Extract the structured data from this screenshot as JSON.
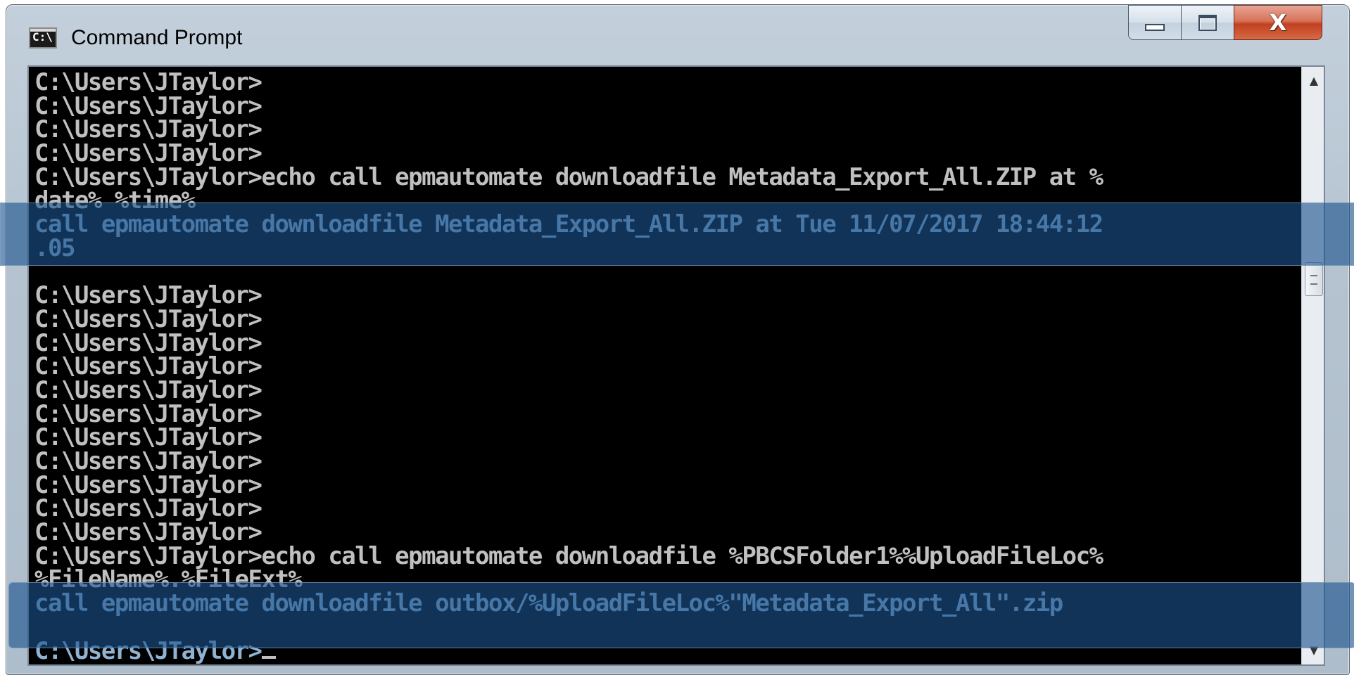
{
  "window": {
    "title": "Command Prompt",
    "icon": "cmd-icon",
    "icon_text": "C:\\",
    "controls": {
      "minimize": "minimize-icon",
      "maximize": "maximize-icon",
      "close_label": "X"
    }
  },
  "console": {
    "lines": [
      "C:\\Users\\JTaylor>",
      "C:\\Users\\JTaylor>",
      "C:\\Users\\JTaylor>",
      "C:\\Users\\JTaylor>",
      "C:\\Users\\JTaylor>echo call epmautomate downloadfile Metadata_Export_All.ZIP at %",
      "date% %time%",
      "call epmautomate downloadfile Metadata_Export_All.ZIP at Tue 11/07/2017 18:44:12",
      ".05",
      "",
      "C:\\Users\\JTaylor>",
      "C:\\Users\\JTaylor>",
      "C:\\Users\\JTaylor>",
      "C:\\Users\\JTaylor>",
      "C:\\Users\\JTaylor>",
      "C:\\Users\\JTaylor>",
      "C:\\Users\\JTaylor>",
      "C:\\Users\\JTaylor>",
      "C:\\Users\\JTaylor>",
      "C:\\Users\\JTaylor>",
      "C:\\Users\\JTaylor>",
      "C:\\Users\\JTaylor>echo call epmautomate downloadfile %PBCSFolder1%%UploadFileLoc%",
      "%FileName%.%FileExt%",
      "call epmautomate downloadfile outbox/%UploadFileLoc%\"Metadata_Export_All\".zip",
      "",
      "C:\\Users\\JTaylor>"
    ],
    "highlighted_line_indices": [
      6,
      7,
      22,
      23,
      24
    ],
    "cursor_after_last_line": true
  },
  "scrollbar": {
    "up_icon": "scroll-up-arrow-icon",
    "down_icon": "scroll-down-arrow-icon",
    "position": 0.33
  },
  "colors": {
    "console_bg": "#000000",
    "console_fg": "#c0c0c0",
    "highlight": "#1c528c",
    "highlight_text": "#8fb3d3",
    "close_button": "#c2401f"
  }
}
